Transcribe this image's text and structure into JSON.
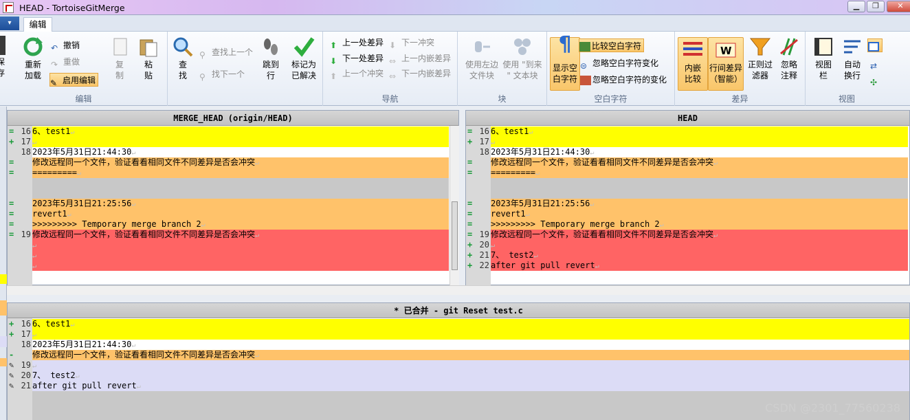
{
  "window": {
    "title": "HEAD - TortoiseGitMerge"
  },
  "ribbon_tab": "编辑",
  "groups": {
    "edit": {
      "label": "编辑",
      "reload": "重新\n加载",
      "undo": "撤销",
      "redo": "重做",
      "enable_edit": "启用编辑",
      "copy": "复\n制",
      "paste": "粘\n贴",
      "find": "查\n找",
      "find_prev": "查找上一个",
      "find_next": "找下一个",
      "goto_line": "跳到\n行",
      "mark_resolved": "标记为\n已解决"
    },
    "nav": {
      "label": "导航",
      "prev_diff": "上一处差异",
      "next_diff": "下一处差异",
      "prev_conflict": "上一个冲突",
      "next_conflict": "下一冲突",
      "prev_inline": "上一内嵌差异",
      "next_inline": "下一内嵌差异"
    },
    "block": {
      "label": "块",
      "use_left": "使用左边\n文件块",
      "use_block": "使用 \"到来\n\" 文本块"
    },
    "whitespace": {
      "label": "空白字符",
      "show_ws": "显示空\n白字符",
      "compare_ws": "比较空白字符",
      "ignore_ws_change": "忽略空白字符变化",
      "ignore_all_ws": "忽略空白字符的变化"
    },
    "diff": {
      "label": "差异",
      "inline": "内嵌\n比较",
      "line_diff": "行间差异\n（智能）",
      "regex_filter": "正则过\n滤器",
      "ignore_comments": "忽略\n注释"
    },
    "view": {
      "label": "视图",
      "view_bar": "视图\n栏",
      "auto_wrap": "自动\n换行"
    }
  },
  "left_pane": {
    "header": "MERGE_HEAD (origin/HEAD)",
    "lines": [
      {
        "mark": "=",
        "num": "16",
        "text": "6、test1",
        "bg": "yellow"
      },
      {
        "mark": "+",
        "num": "17",
        "text": "",
        "bg": "yellow"
      },
      {
        "mark": "",
        "num": "18",
        "text": "2023年5月31日21:44:30",
        "bg": "white"
      },
      {
        "mark": "=",
        "num": "",
        "text": "修改远程同一个文件，验证看看相同文件不同差异是否会冲突",
        "bg": "orange"
      },
      {
        "mark": "=",
        "num": "",
        "text": "=========",
        "bg": "orange"
      },
      {
        "mark": "",
        "num": "",
        "text": "",
        "bg": "grey"
      },
      {
        "mark": "",
        "num": "",
        "text": "",
        "bg": "grey"
      },
      {
        "mark": "=",
        "num": "",
        "text": "2023年5月31日21:25:56",
        "bg": "orange"
      },
      {
        "mark": "=",
        "num": "",
        "text": "revert1",
        "bg": "orange"
      },
      {
        "mark": "=",
        "num": "",
        "text": ">>>>>>>>> Temporary merge branch 2",
        "bg": "orange"
      },
      {
        "mark": "=",
        "num": "19",
        "text": "修改远程同一个文件，验证看看相同文件不同差异是否会冲突",
        "bg": "red"
      },
      {
        "mark": "",
        "num": "",
        "text": "",
        "bg": "red"
      },
      {
        "mark": "",
        "num": "",
        "text": "",
        "bg": "red"
      },
      {
        "mark": "",
        "num": "",
        "text": "",
        "bg": "red"
      }
    ]
  },
  "right_pane": {
    "header": "HEAD",
    "lines": [
      {
        "mark": "=",
        "num": "16",
        "text": "6、test1",
        "bg": "yellow"
      },
      {
        "mark": "+",
        "num": "17",
        "text": "",
        "bg": "yellow"
      },
      {
        "mark": "",
        "num": "18",
        "text": "2023年5月31日21:44:30",
        "bg": "white"
      },
      {
        "mark": "=",
        "num": "",
        "text": "修改远程同一个文件，验证看看相同文件不同差异是否会冲突",
        "bg": "orange"
      },
      {
        "mark": "=",
        "num": "",
        "text": "=========",
        "bg": "orange"
      },
      {
        "mark": "",
        "num": "",
        "text": "",
        "bg": "grey"
      },
      {
        "mark": "",
        "num": "",
        "text": "",
        "bg": "grey"
      },
      {
        "mark": "=",
        "num": "",
        "text": "2023年5月31日21:25:56",
        "bg": "orange"
      },
      {
        "mark": "=",
        "num": "",
        "text": "revert1",
        "bg": "orange"
      },
      {
        "mark": "=",
        "num": "",
        "text": ">>>>>>>>> Temporary merge branch 2",
        "bg": "orange"
      },
      {
        "mark": "=",
        "num": "19",
        "text": "修改远程同一个文件，验证看看相同文件不同差异是否会冲突",
        "bg": "red"
      },
      {
        "mark": "+",
        "num": "20",
        "text": "",
        "bg": "red"
      },
      {
        "mark": "+",
        "num": "21",
        "text": "7、 test2",
        "bg": "red"
      },
      {
        "mark": "+",
        "num": "22",
        "text": "after git pull revert",
        "bg": "red"
      }
    ]
  },
  "bottom_pane": {
    "header": "* 已合并 - git Reset test.c",
    "lines": [
      {
        "mark": "+",
        "num": "16",
        "text": "6、test1",
        "bg": "yellow"
      },
      {
        "mark": "+",
        "num": "17",
        "text": "",
        "bg": "yellow"
      },
      {
        "mark": "",
        "num": "18",
        "text": "2023年5月31日21:44:30",
        "bg": "white"
      },
      {
        "mark": "-",
        "num": "",
        "text": "修改远程同一个文件，验证看看相同文件不同差异是否会冲突",
        "bg": "orange"
      },
      {
        "mark": "✎",
        "num": "19",
        "text": "",
        "bg": "lav"
      },
      {
        "mark": "✎",
        "num": "20",
        "text": "7、 test2",
        "bg": "lav"
      },
      {
        "mark": "✎",
        "num": "21",
        "text": "after git pull revert",
        "bg": "lav"
      }
    ]
  },
  "watermark": "CSDN @2301_77560238"
}
